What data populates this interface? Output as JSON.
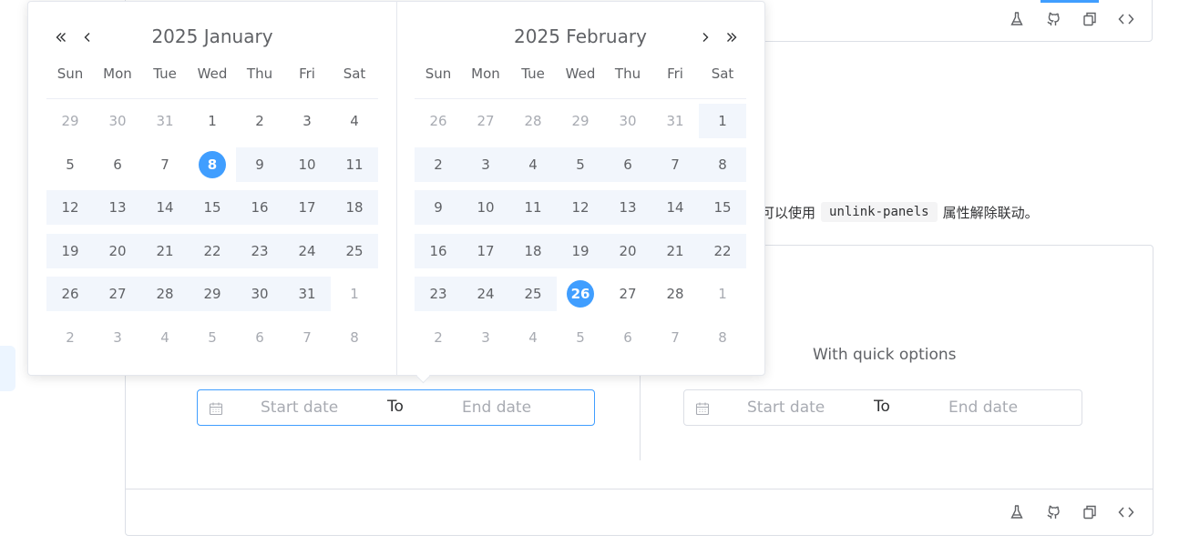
{
  "description": {
    "prefix": "，可以使用",
    "code": "unlink-panels",
    "suffix": "属性解除联动。"
  },
  "icons": {
    "toolbar": [
      "flask-icon",
      "github-icon",
      "copy-icon",
      "code-icon"
    ]
  },
  "demo": {
    "quick_options_label": "With quick options",
    "picker1": {
      "start_placeholder": "Start date",
      "separator": "To",
      "end_placeholder": "End date"
    },
    "picker2": {
      "start_placeholder": "Start date",
      "separator": "To",
      "end_placeholder": "End date"
    }
  },
  "colors": {
    "accent": "#409eff",
    "range_bg": "#f2f6fc",
    "border": "#dcdfe6"
  },
  "calendar": {
    "weekdays": [
      "Sun",
      "Mon",
      "Tue",
      "Wed",
      "Thu",
      "Fri",
      "Sat"
    ],
    "left": {
      "title": "2025 January",
      "weeks": [
        [
          [
            "29",
            "o"
          ],
          [
            "30",
            "o"
          ],
          [
            "31",
            "o"
          ],
          [
            "1",
            ""
          ],
          [
            "2",
            ""
          ],
          [
            "3",
            ""
          ],
          [
            "4",
            ""
          ]
        ],
        [
          [
            "5",
            ""
          ],
          [
            "6",
            ""
          ],
          [
            "7",
            ""
          ],
          [
            "8",
            "s"
          ],
          [
            "9",
            "r"
          ],
          [
            "10",
            "r"
          ],
          [
            "11",
            "r"
          ]
        ],
        [
          [
            "12",
            "r"
          ],
          [
            "13",
            "r"
          ],
          [
            "14",
            "r"
          ],
          [
            "15",
            "r"
          ],
          [
            "16",
            "r"
          ],
          [
            "17",
            "r"
          ],
          [
            "18",
            "r"
          ]
        ],
        [
          [
            "19",
            "r"
          ],
          [
            "20",
            "r"
          ],
          [
            "21",
            "r"
          ],
          [
            "22",
            "r"
          ],
          [
            "23",
            "r"
          ],
          [
            "24",
            "r"
          ],
          [
            "25",
            "r"
          ]
        ],
        [
          [
            "26",
            "r"
          ],
          [
            "27",
            "r"
          ],
          [
            "28",
            "r"
          ],
          [
            "29",
            "r"
          ],
          [
            "30",
            "r"
          ],
          [
            "31",
            "r"
          ],
          [
            "1",
            "o"
          ]
        ],
        [
          [
            "2",
            "o"
          ],
          [
            "3",
            "o"
          ],
          [
            "4",
            "o"
          ],
          [
            "5",
            "o"
          ],
          [
            "6",
            "o"
          ],
          [
            "7",
            "o"
          ],
          [
            "8",
            "o"
          ]
        ]
      ]
    },
    "right": {
      "title": "2025 February",
      "weeks": [
        [
          [
            "26",
            "o"
          ],
          [
            "27",
            "o"
          ],
          [
            "28",
            "o"
          ],
          [
            "29",
            "o"
          ],
          [
            "30",
            "o"
          ],
          [
            "31",
            "o"
          ],
          [
            "1",
            "r"
          ]
        ],
        [
          [
            "2",
            "r"
          ],
          [
            "3",
            "r"
          ],
          [
            "4",
            "r"
          ],
          [
            "5",
            "r"
          ],
          [
            "6",
            "r"
          ],
          [
            "7",
            "r"
          ],
          [
            "8",
            "r"
          ]
        ],
        [
          [
            "9",
            "r"
          ],
          [
            "10",
            "r"
          ],
          [
            "11",
            "r"
          ],
          [
            "12",
            "r"
          ],
          [
            "13",
            "r"
          ],
          [
            "14",
            "r"
          ],
          [
            "15",
            "r"
          ]
        ],
        [
          [
            "16",
            "r"
          ],
          [
            "17",
            "r"
          ],
          [
            "18",
            "r"
          ],
          [
            "19",
            "r"
          ],
          [
            "20",
            "r"
          ],
          [
            "21",
            "r"
          ],
          [
            "22",
            "r"
          ]
        ],
        [
          [
            "23",
            "r"
          ],
          [
            "24",
            "r"
          ],
          [
            "25",
            "r"
          ],
          [
            "26",
            "s"
          ],
          [
            "27",
            ""
          ],
          [
            "28",
            ""
          ],
          [
            "1",
            "o"
          ]
        ],
        [
          [
            "2",
            "o"
          ],
          [
            "3",
            "o"
          ],
          [
            "4",
            "o"
          ],
          [
            "5",
            "o"
          ],
          [
            "6",
            "o"
          ],
          [
            "7",
            "o"
          ],
          [
            "8",
            "o"
          ]
        ]
      ]
    }
  }
}
